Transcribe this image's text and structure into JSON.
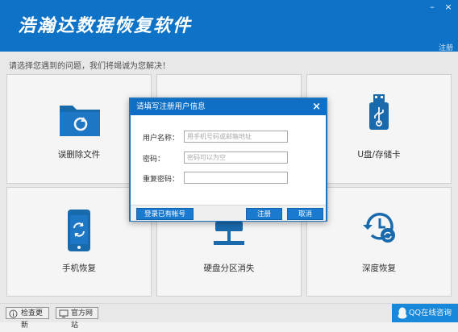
{
  "window": {
    "title": "浩瀚达数据恢复软件",
    "minimize": "–",
    "close": "×",
    "register_link": "注册"
  },
  "subtitle": "请选择您遇到的问题，我们将竭诚为您解决！",
  "cards": [
    {
      "label": "误删除文件",
      "icon": "folder-refresh-icon"
    },
    {
      "label": "",
      "icon": "hidden"
    },
    {
      "label": "U盘/存储卡",
      "icon": "usb-drive-icon"
    },
    {
      "label": "手机恢复",
      "icon": "phone-refresh-icon"
    },
    {
      "label": "硬盘分区消失",
      "icon": "network-drive-icon"
    },
    {
      "label": "深度恢复",
      "icon": "clock-restore-icon"
    }
  ],
  "bottom": {
    "check_update": "检查更新",
    "official_site": "官方网站",
    "qq_consult": "QQ在线咨询"
  },
  "dialog": {
    "title": "请填写注册用户信息",
    "close": "×",
    "fields": [
      {
        "label": "用户名称：",
        "placeholder": "用手机号码或邮箱地址",
        "value": ""
      },
      {
        "label": "密码：",
        "placeholder": "密码可以为空",
        "value": ""
      },
      {
        "label": "重复密码：",
        "placeholder": "",
        "value": ""
      }
    ],
    "login_existing": "登录已有帐号",
    "register": "注册",
    "cancel": "取消"
  },
  "colors": {
    "brand_blue": "#0e73c6",
    "icon_blue": "#1b6fb5"
  }
}
